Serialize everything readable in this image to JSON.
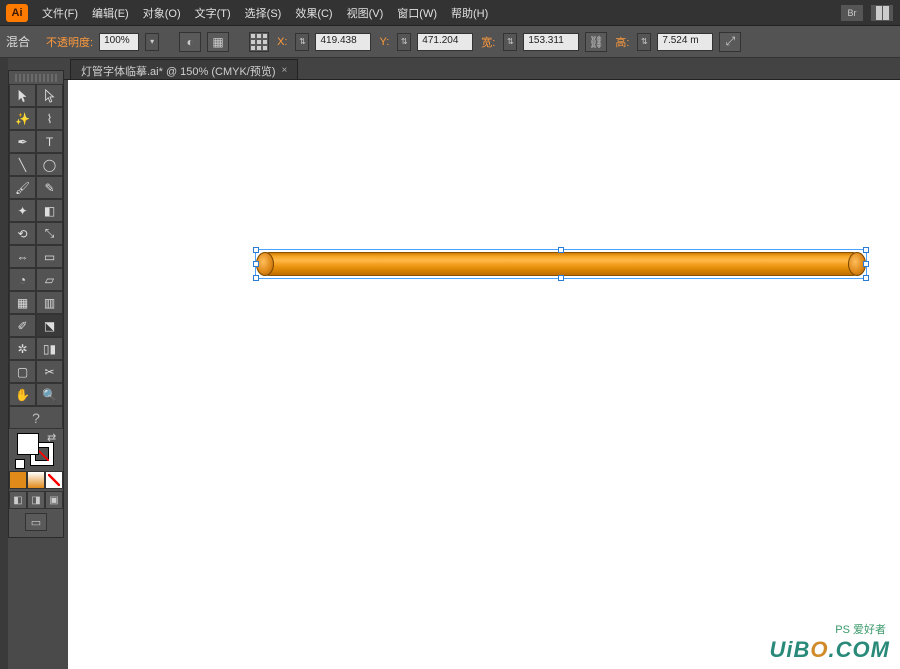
{
  "app": {
    "logo": "Ai"
  },
  "menu": {
    "file": "文件(F)",
    "edit": "编辑(E)",
    "object": "对象(O)",
    "type": "文字(T)",
    "select": "选择(S)",
    "effect": "效果(C)",
    "view": "视图(V)",
    "window": "窗口(W)",
    "help": "帮助(H)",
    "bridge": "Br"
  },
  "options": {
    "blend_label": "混合",
    "opacity_label": "不透明度:",
    "opacity_value": "100%",
    "x_label": "X:",
    "x_value": "419.438",
    "y_label": "Y:",
    "y_value": "471.204",
    "w_label": "宽:",
    "w_value": "153.311",
    "h_label": "高:",
    "h_value": "7.524 m",
    "link_icon": "⛓"
  },
  "document": {
    "tab_title": "灯管字体临摹.ai* @ 150% (CMYK/预览)",
    "close": "×"
  },
  "tools": {
    "help": "?"
  },
  "watermark": {
    "small": "PS 爱好者",
    "main_pre": "UiB",
    "main_o": "O",
    "main_post": ".COM"
  }
}
